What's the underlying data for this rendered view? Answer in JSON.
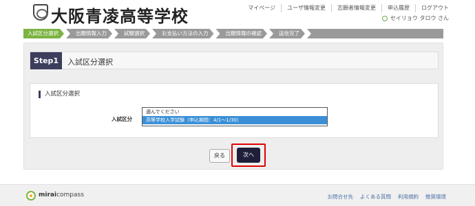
{
  "header": {
    "school_name": "大阪青凌高等学校",
    "nav": [
      "マイページ",
      "ユーザ情報変更",
      "志願者情報変更",
      "申込履歴",
      "ログアウト"
    ],
    "user_name": "セイリョウ タロウ さん"
  },
  "steps": [
    {
      "label": "入試区分選択",
      "active": true
    },
    {
      "label": "出願情報入力",
      "active": false
    },
    {
      "label": "試験選択",
      "active": false
    },
    {
      "label": "お支払い方法の入力",
      "active": false
    },
    {
      "label": "出願情報の確認",
      "active": false
    },
    {
      "label": "送信完了",
      "active": false
    }
  ],
  "main": {
    "step_badge": "Step1",
    "step_title": "入試区分選択",
    "section_heading": "入試区分選択",
    "field_label": "入試区分",
    "options": [
      "選んでください",
      "高等学校入学試験（申込期間：4/1～1/30）"
    ],
    "selected_option_index": 1,
    "back_label": "戻る",
    "next_label": "次へ"
  },
  "footer": {
    "logo_brand": "mirai",
    "logo_suffix": "compass",
    "links": [
      "お問合せ先",
      "よくある質問",
      "利用規約",
      "推奨環境"
    ]
  },
  "colors": {
    "active_step": "#7cb342",
    "inactive_step": "#9a9a9a",
    "badge": "#3d3d5c",
    "selected_option": "#3a8fd6",
    "highlight_frame": "#e00000"
  }
}
